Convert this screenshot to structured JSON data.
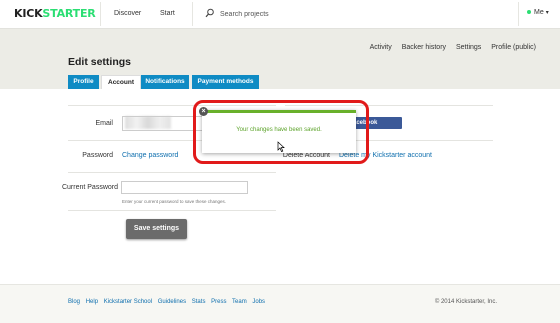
{
  "topnav": {
    "logo_left": "KICK",
    "logo_right": "STARTER",
    "discover": "Discover",
    "start": "Start",
    "search_placeholder": "Search projects",
    "me": "Me"
  },
  "subnav": {
    "items": [
      "Activity",
      "Backer history",
      "Settings",
      "Profile (public)"
    ]
  },
  "page_title": "Edit settings",
  "tabs": [
    "Profile",
    "Account",
    "Notifications",
    "Payment methods"
  ],
  "active_tab": "Account",
  "form": {
    "email_label": "Email",
    "facebook_button": "... with Facebook",
    "password_label": "Password",
    "change_password": "Change password",
    "delete_account_label": "Delete Account",
    "delete_account_link": "Delete my Kickstarter account",
    "current_password_label": "Current Password",
    "current_password_hint": "Enter your current password to save these changes.",
    "save_button": "Save settings"
  },
  "flash": {
    "message": "Your changes have been saved.",
    "close": "×"
  },
  "footer": {
    "links": [
      "Blog",
      "Help",
      "Kickstarter School",
      "Guidelines",
      "Stats",
      "Press",
      "Team",
      "Jobs"
    ],
    "copyright": "© 2014 Kickstarter, Inc."
  },
  "colors": {
    "brand_green": "#2bde73",
    "tab_blue": "#0f8bc4",
    "link_blue": "#0f6fae",
    "highlight_red": "#e11a1a",
    "success_green": "#68b02a"
  }
}
